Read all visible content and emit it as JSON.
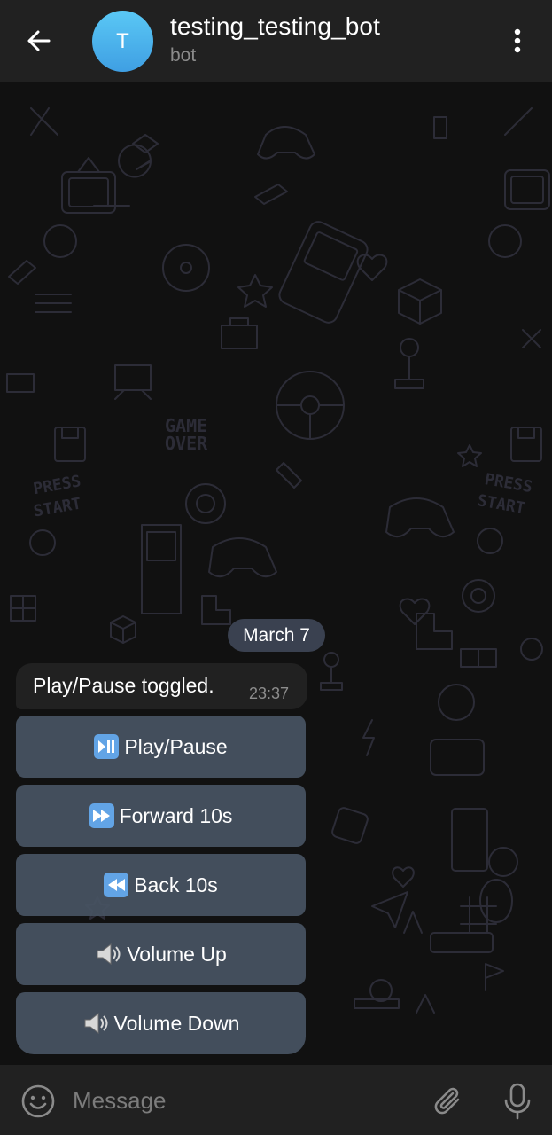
{
  "header": {
    "back_icon": "arrow-left-icon",
    "avatar_letter": "T",
    "title": "testing_testing_bot",
    "subtitle": "bot",
    "menu_icon": "more-vertical-icon"
  },
  "chat": {
    "date_label": "March 7",
    "message": {
      "text": "Play/Pause toggled.",
      "time": "23:37"
    },
    "keyboard": [
      {
        "icon": "play-pause-icon",
        "label": "Play/Pause"
      },
      {
        "icon": "fast-forward-icon",
        "label": "Forward 10s"
      },
      {
        "icon": "rewind-icon",
        "label": "Back 10s"
      },
      {
        "icon": "speaker-icon",
        "label": "Volume Up"
      },
      {
        "icon": "speaker-icon",
        "label": "Volume Down"
      }
    ]
  },
  "input_bar": {
    "emoji_icon": "smiley-icon",
    "placeholder": "Message",
    "attach_icon": "paperclip-icon",
    "mic_icon": "microphone-icon"
  },
  "colors": {
    "header_bg": "#212121",
    "chat_bg": "#111111",
    "avatar": "#4aaee9",
    "keyboard_button": "#485463",
    "date_pill": "#3a4150"
  }
}
